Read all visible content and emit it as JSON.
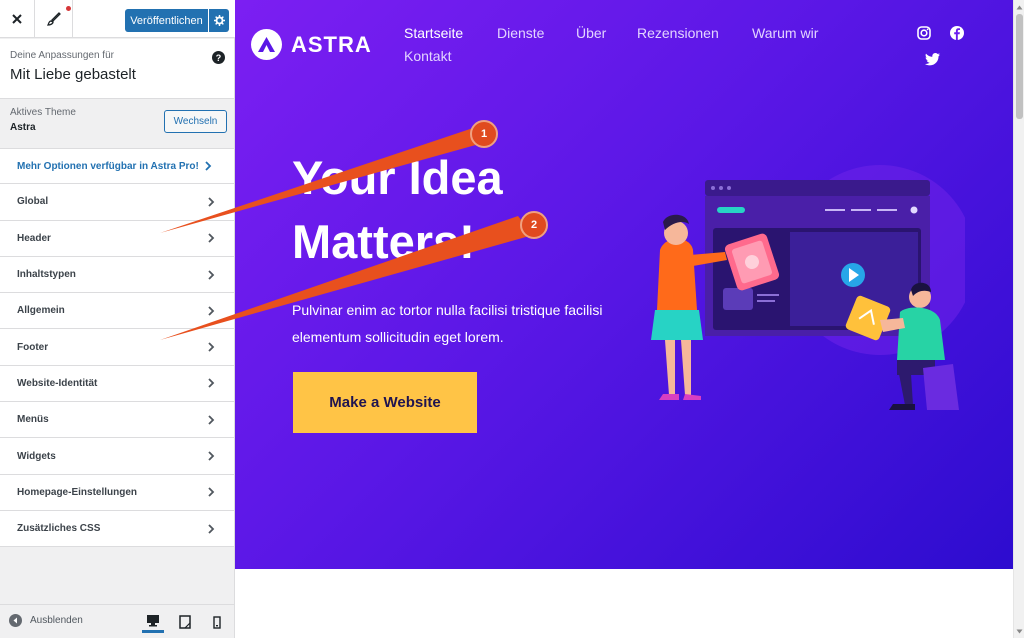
{
  "customizer": {
    "publish_label": "Veröffentlichen",
    "subtitle": "Deine Anpassungen für",
    "site_title": "Mit Liebe gebastelt",
    "theme_label": "Aktives Theme",
    "theme_name": "Astra",
    "switch_label": "Wechseln",
    "pro_label": "Mehr Optionen verfügbar in Astra Pro!",
    "menu": [
      "Global",
      "Header",
      "Inhaltstypen",
      "Allgemein",
      "Footer",
      "Website-Identität",
      "Menüs",
      "Widgets",
      "Homepage-Einstellungen",
      "Zusätzliches CSS"
    ],
    "hide_label": "Ausblenden",
    "accent_color": "#2271b1"
  },
  "site": {
    "logo_text": "ASTRA",
    "nav": [
      "Startseite",
      "Dienste",
      "Über",
      "Rezensionen",
      "Warum wir",
      "Kontakt"
    ],
    "active_nav": "Startseite",
    "social_icons": [
      "instagram-icon",
      "facebook-icon",
      "twitter-icon"
    ],
    "hero_title_line1": "Your Idea",
    "hero_title_line2": "Matters!",
    "hero_text_line1": "Pulvinar enim ac tortor nulla facilisi tristique facilisi",
    "hero_text_line2": "elementum sollicitudin eget lorem.",
    "cta_label": "Make a Website",
    "hero_gradient": [
      "#7c1ff2",
      "#2d0ccf"
    ],
    "cta_color": "#ffc446"
  },
  "annotations": {
    "badge_1": "1",
    "badge_2": "2",
    "arrow_color": "#e8501e"
  }
}
